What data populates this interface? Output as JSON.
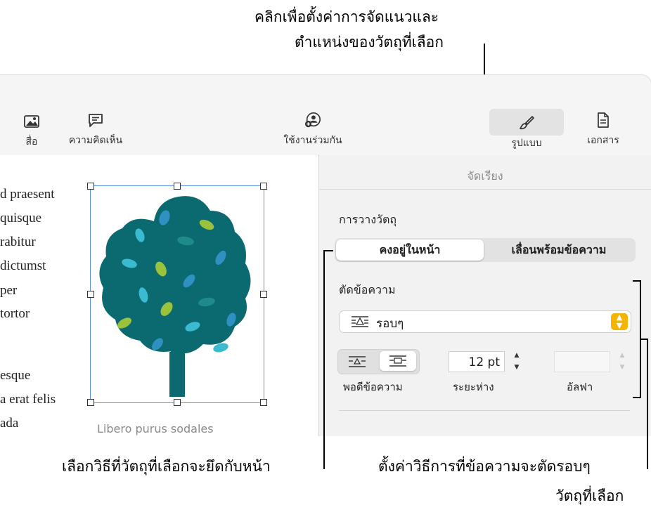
{
  "callouts": {
    "top_line1": "คลิกเพื่อตั้งค่าการจัดแนวและ",
    "top_line2": "ตำแหน่งของวัตถุที่เลือก",
    "bottom_left": "เลือกวิธีที่วัตถุที่เลือกจะยึดกับหน้า",
    "bottom_right_line1": "ตั้งค่าวิธีการที่ข้อความจะตัดรอบๆ",
    "bottom_right_line2": "วัตถุที่เลือก"
  },
  "toolbar": {
    "media_label": "สื่อ",
    "comment_label": "ความคิดเห็น",
    "collaborate_label": "ใช้งานร่วมกัน",
    "format_label": "รูปแบบ",
    "document_label": "เอกสาร",
    "icons": [
      "image-icon",
      "comment-icon",
      "collaborate-icon",
      "paintbrush-icon",
      "document-icon"
    ]
  },
  "document": {
    "lines": [
      "d praesent",
      "quisque",
      "rabitur",
      "dictumst",
      "per",
      "tortor",
      "esque",
      "a erat felis",
      "ada"
    ],
    "caption": "Libero purus sodales"
  },
  "panel": {
    "tab_title": "จัดเรียง",
    "object_placement_label": "การวางวัตถุ",
    "placement_options": [
      "คงอยู่ในหน้า",
      "เลื่อนพร้อมข้อความ"
    ],
    "selected_placement": "คงอยู่ในหน้า",
    "text_wrap_label": "ตัดข้อความ",
    "wrap_value": "รอบๆ",
    "fit_label": "พอดีข้อความ",
    "spacing_label": "ระยะห่าง",
    "spacing_value": "12 pt",
    "alpha_label": "อัลฟา",
    "alpha_value": ""
  },
  "colors": {
    "accent": "#f5b400",
    "tree_trunk": "#0b6a70",
    "selection": "#5a8ff0"
  }
}
